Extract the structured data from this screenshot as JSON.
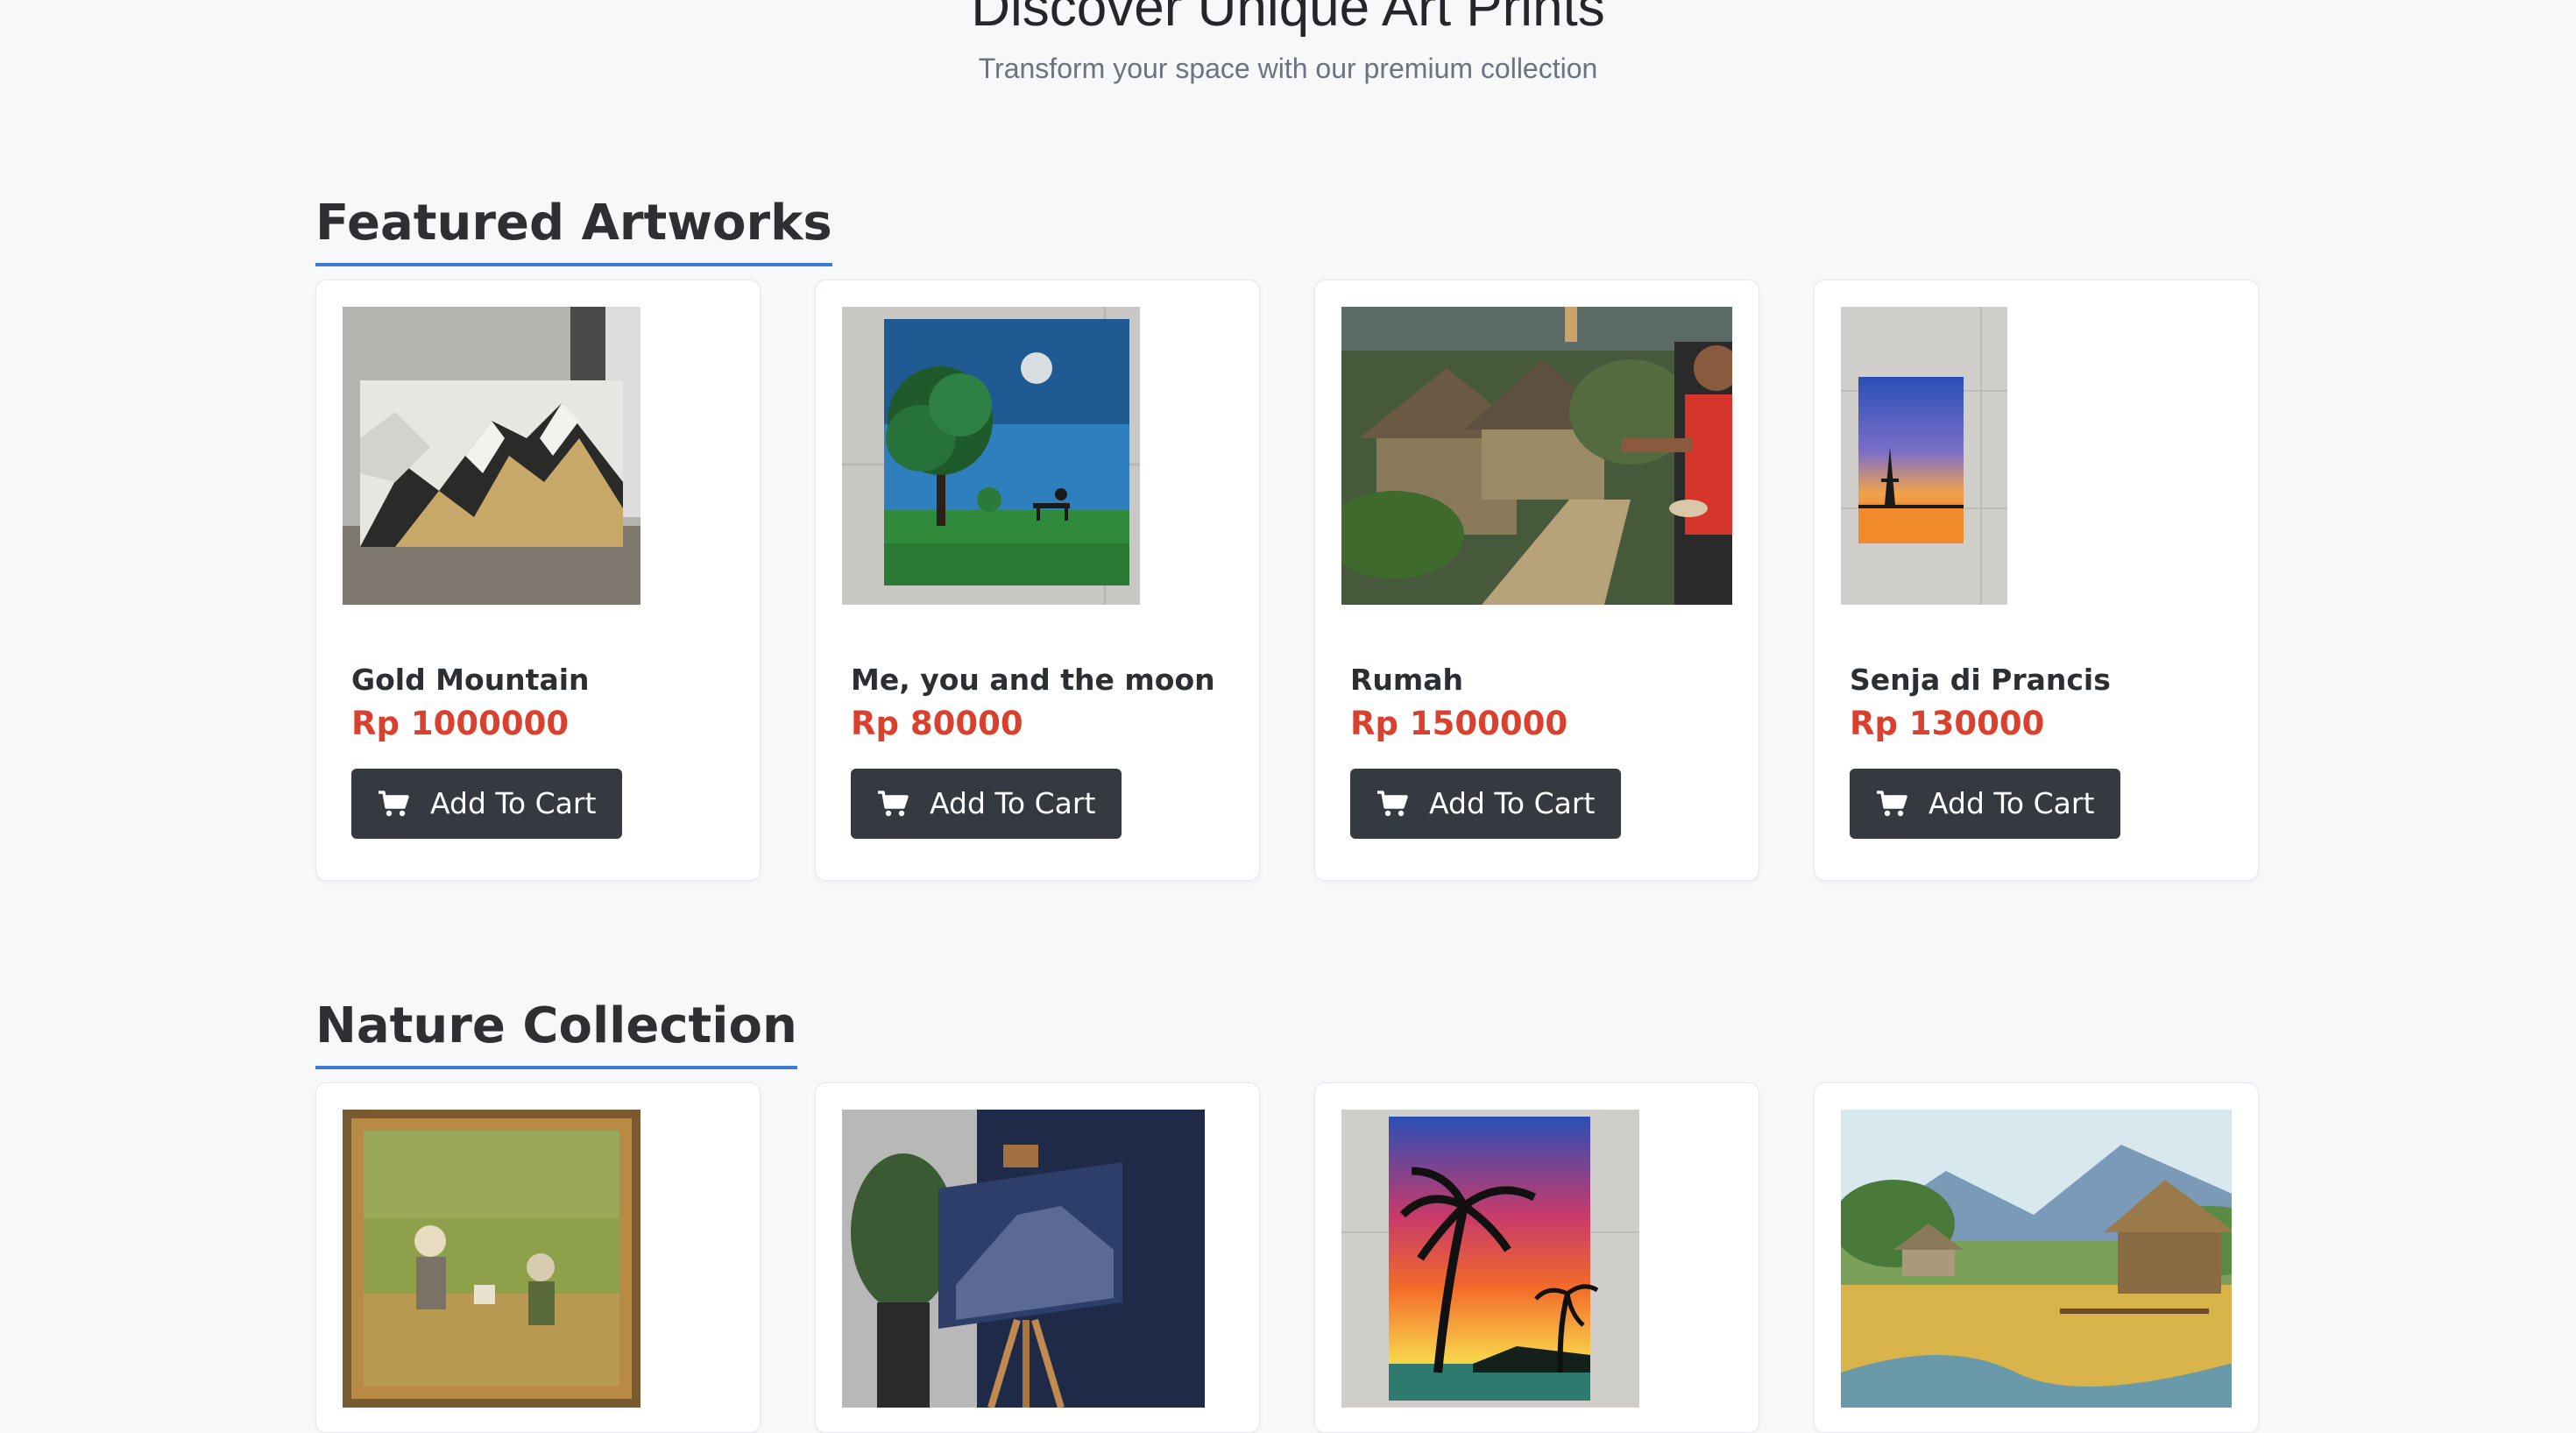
{
  "hero": {
    "title": "Discover Unique Art Prints",
    "subtitle": "Transform your space with our premium collection"
  },
  "sections": {
    "featured": {
      "heading": "Featured Artworks",
      "products": [
        {
          "title": "Gold Mountain",
          "price": "Rp 1000000",
          "button": "Add To Cart"
        },
        {
          "title": "Me, you and the moon",
          "price": "Rp 80000",
          "button": "Add To Cart"
        },
        {
          "title": "Rumah",
          "price": "Rp 1500000",
          "button": "Add To Cart"
        },
        {
          "title": "Senja di Prancis",
          "price": "Rp 130000",
          "button": "Add To Cart"
        }
      ]
    },
    "nature": {
      "heading": "Nature Collection"
    }
  },
  "icons": {
    "cart": "cart-icon"
  },
  "colors": {
    "accent": "#3a7bd5",
    "price": "#d9412e",
    "button": "#343a40",
    "background": "#f7f8fa"
  }
}
